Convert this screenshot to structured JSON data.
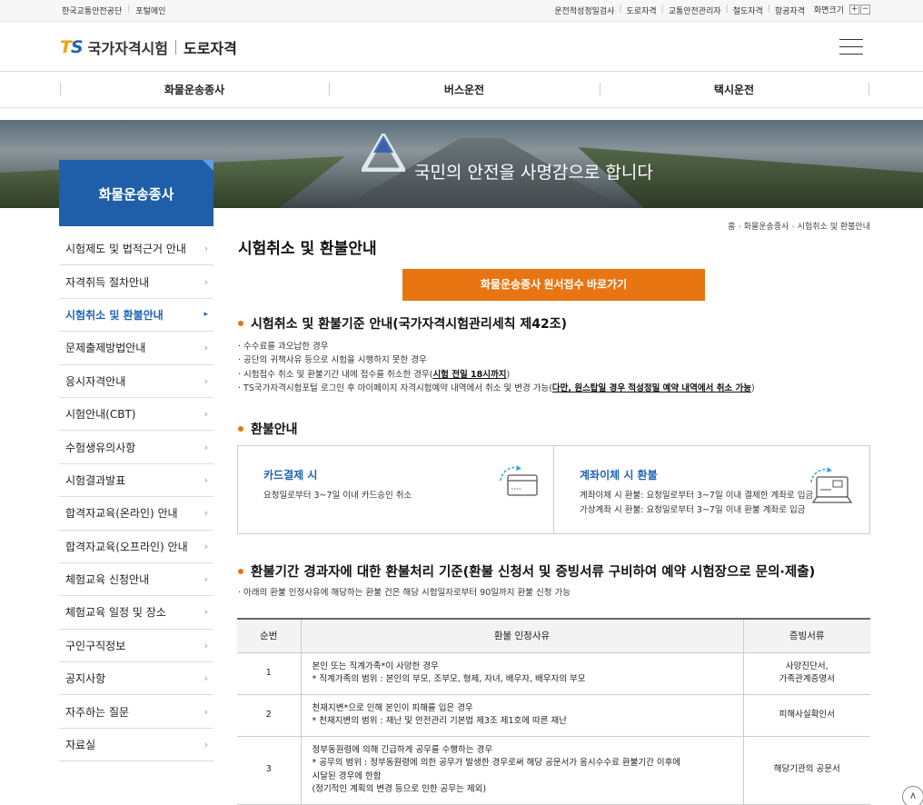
{
  "util": {
    "left_links": [
      "한국교통안전공단",
      "포털메인"
    ],
    "right_links": [
      "운전적성정밀검사",
      "도로자격",
      "교통안전관리자",
      "철도자격",
      "항공자격"
    ],
    "zoom_label": "화면크기",
    "zoom_in": "+",
    "zoom_out": "−"
  },
  "header": {
    "logo_t": "T",
    "logo_s": "S",
    "logo_name": "국가자격시험",
    "logo_sub": "도로자격"
  },
  "gnb": [
    "화물운송종사",
    "버스운전",
    "택시운전"
  ],
  "hero": {
    "slogan": "국민의 안전을 사명감으로 합니다"
  },
  "lnb": {
    "title": "화물운송종사",
    "items": [
      "시험제도 및 법적근거 안내",
      "자격취득 절차안내",
      "시험취소 및 환불안내",
      "문제출제방법안내",
      "응시자격안내",
      "시험안내(CBT)",
      "수험생유의사항",
      "시험결과발표",
      "합격자교육(온라인) 안내",
      "합격자교육(오프라인) 안내",
      "체험교육 신청안내",
      "체험교육 일정 및 장소",
      "구인구직정보",
      "공지사항",
      "자주하는 질문",
      "자료실"
    ],
    "active_index": 2
  },
  "breadcrumb": [
    "홈",
    "화물운송종사",
    "시험취소 및 환불안내"
  ],
  "page_title": "시험취소 및 환불안내",
  "apply_button": "화물운송종사 원서접수 바로가기",
  "section1": {
    "heading": "시험취소 및 환불기준 안내(국가자격시험관리세칙 제42조)",
    "bullets": [
      "· 수수료를 과오납한 경우",
      "· 공단의 귀책사유 등으로 시험을 시행하지 못한 경우",
      "· 시험접수 취소 및 환불기간 내에 접수를 취소한 경우(",
      "· TS국가자격시험포털 로그인 후 마이페이지 자격시험예약 내역에서 취소 및 변경 가능("
    ],
    "bullet3_underline": "시험 전일 18시까지",
    "bullet4_underline": "다만, 원스탑일 경우 적성정밀 예약 내역에서 취소 가능",
    "close_paren": ")"
  },
  "section2": {
    "heading": "환불안내",
    "card": {
      "title": "카드결제 시",
      "desc": "요청일로부터 3~7일 이내 카드승인 취소"
    },
    "transfer": {
      "title": "계좌이체 시 환불",
      "line1": "계좌이체 시 환불: 요청일로부터 3~7일 이내 결제한 계좌로 입금",
      "line2": "가상계좌 시 환불: 요청일로부터 3~7일 이내 환불 계좌로 입금"
    }
  },
  "section3": {
    "heading": "환불기간 경과자에 대한 환불처리 기준(환불 신청서 및 증빙서류 구비하여 예약 시험장으로 문의·제출)",
    "note": "· 아래의 환불 인정사유에 해당하는 환불 건은 해당 시험일자로부터 90일까지 환불 신청 가능",
    "table": {
      "headers": [
        "순번",
        "환불 인정사유",
        "증빙서류"
      ],
      "rows": [
        {
          "no": "1",
          "reason": [
            "본인 또는 직계가족*이 사망한 경우",
            "* 직계가족의 범위 : 본인의 부모, 조부모, 형제, 자녀, 배우자, 배우자의 부모"
          ],
          "doc": [
            "사망진단서,",
            "가족관계증명서"
          ]
        },
        {
          "no": "2",
          "reason": [
            "천재지변*으로 인해 본인이 피해를 입은 경우",
            "* 천재지변의 범위 : 재난 및 안전관리 기본법 제3조 제1호에 따른 재난"
          ],
          "doc": [
            "피해사실확인서"
          ]
        },
        {
          "no": "3",
          "reason": [
            "정부동원령에 의해 긴급하게 공무를 수행하는 경우",
            "* 공무의 범위 : 정부동원령에 의한 공무가 발생한 경우로써 해당 공문서가 응시수수료 환불기간 이후에",
            "시달된 경우에 한함",
            "(정기적인 계획의 변경 등으로 인한 공무는 제외)"
          ],
          "doc": [
            "해당기관의 공문서"
          ]
        }
      ]
    }
  },
  "top_button": "∧",
  "colors": {
    "brand_blue": "#1f5ea8",
    "accent_orange": "#e87511"
  }
}
